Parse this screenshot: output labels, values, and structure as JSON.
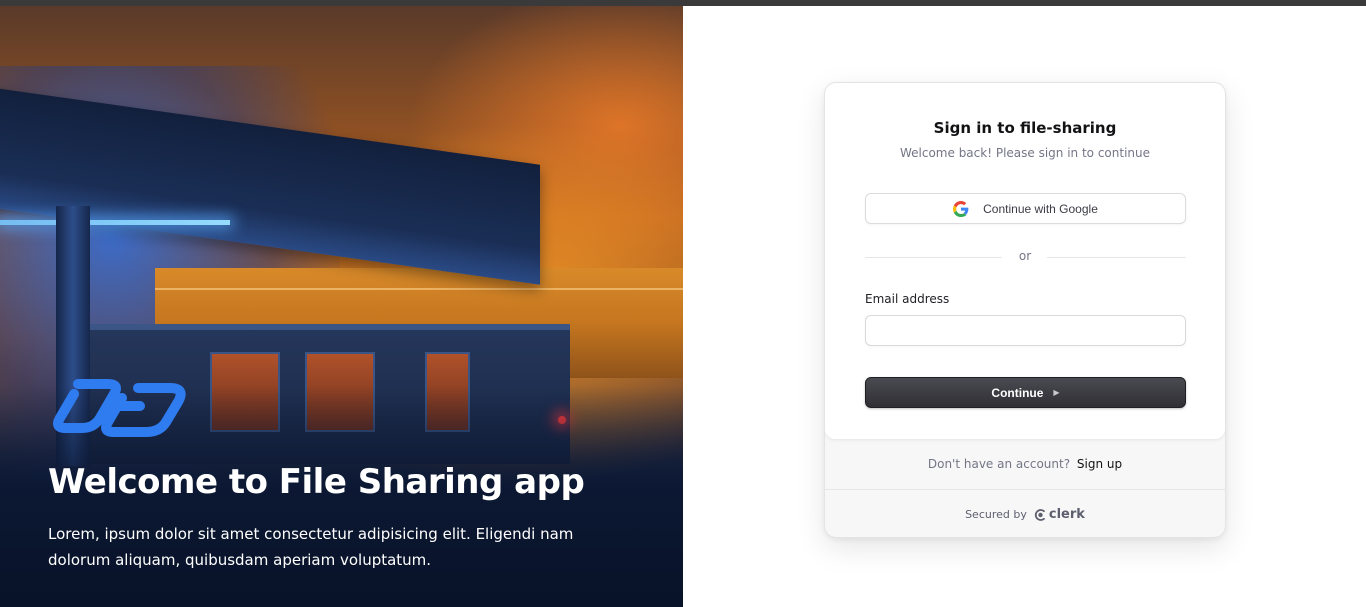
{
  "hero": {
    "title": "Welcome to File Sharing app",
    "description": "Lorem, ipsum dolor sit amet consectetur adipisicing elit. Eligendi nam dolorum aliquam, quibusdam aperiam voluptatum.",
    "logo_icon": "chain-link-icon",
    "logo_color": "#2f7bf0"
  },
  "signin": {
    "title": "Sign in to file-sharing",
    "subtitle": "Welcome back! Please sign in to continue",
    "google_button_label": "Continue with Google",
    "divider_text": "or",
    "email_label": "Email address",
    "email_value": "",
    "continue_label": "Continue",
    "continue_icon": "triangle-right-icon",
    "signup_prompt": "Don't have an account?",
    "signup_link": "Sign up",
    "secured_by": "Secured by",
    "brand": "clerk"
  },
  "colors": {
    "primary_button": "#2f2f35",
    "card_background": "#ffffff",
    "footer_background": "#f7f7f7",
    "logo_blue": "#2f7bf0"
  }
}
